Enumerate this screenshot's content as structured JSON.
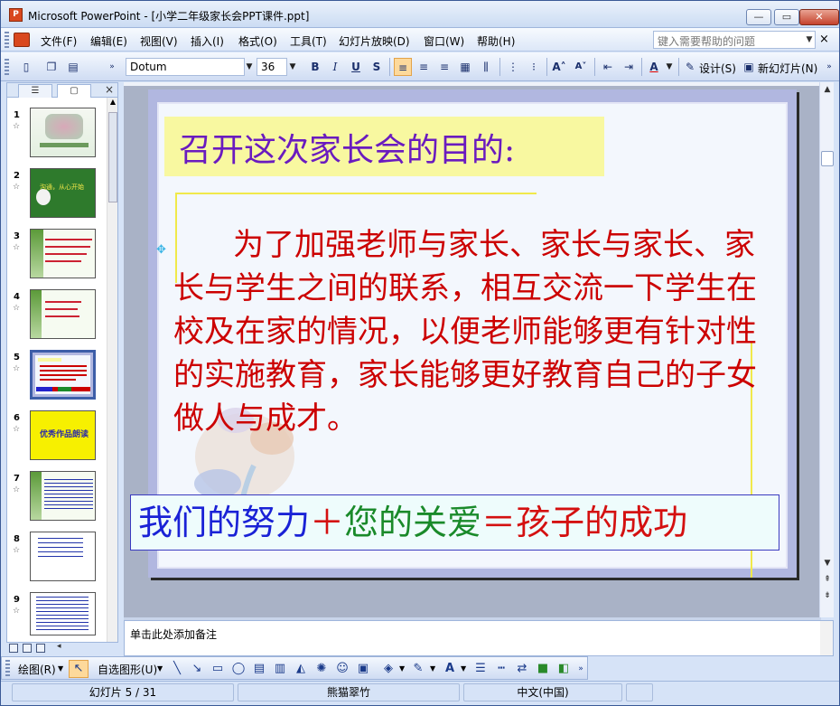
{
  "window": {
    "app_icon": "P",
    "title": "Microsoft PowerPoint - [小学二年级家长会PPT课件.ppt]",
    "minimize": "—",
    "restore": "▭",
    "close": "✕"
  },
  "menubar": {
    "items": [
      "文件(F)",
      "编辑(E)",
      "视图(V)",
      "插入(I)",
      "格式(O)",
      "工具(T)",
      "幻灯片放映(D)",
      "窗口(W)",
      "帮助(H)"
    ],
    "help_placeholder": "键入需要帮助的问题",
    "close_label": "×"
  },
  "toolbar": {
    "font_name": "Dotum",
    "font_size": "36",
    "bold": "B",
    "italic": "I",
    "underline": "U",
    "shadow": "S",
    "design_label": "设计(S)",
    "new_slide_label": "新幻灯片(N)",
    "font_color_label": "A",
    "grow_font": "A˄",
    "shrink_font": "A˅"
  },
  "side_panel": {
    "tabs": [
      "☰",
      "▢"
    ],
    "close": "×",
    "slides": [
      {
        "num": "1",
        "star": "☆"
      },
      {
        "num": "2",
        "star": "☆",
        "thumb_text": "沟通，从心开始"
      },
      {
        "num": "3",
        "star": "☆"
      },
      {
        "num": "4",
        "star": "☆"
      },
      {
        "num": "5",
        "star": "☆"
      },
      {
        "num": "6",
        "star": "☆",
        "thumb_text": "优秀作品朗读"
      },
      {
        "num": "7",
        "star": "☆"
      },
      {
        "num": "8",
        "star": "☆"
      },
      {
        "num": "9",
        "star": "☆"
      }
    ],
    "selected_slide": 5
  },
  "slide": {
    "title": "召开这次家长会的目的:",
    "body": "为了加强老师与家长、家长与家长、家长与学生之间的联系，相互交流一下学生在校及在家的情况，以便老师能够更有针对性的实施教育，家长能够更好教育自己的子女做人与成才。",
    "slogan": {
      "part1": "我们的努力",
      "plus": "＋",
      "part2": "您的关爱",
      "equals": "＝",
      "part3": "孩子的成功"
    },
    "colors": {
      "title": "#6a1bbf",
      "body": "#cc0000",
      "slogan_blue": "#1a22d6",
      "slogan_green": "#1a8a2a",
      "slogan_red": "#d41010"
    }
  },
  "notes": {
    "placeholder": "单击此处添加备注"
  },
  "drawbar": {
    "draw_label": "绘图(R)",
    "autoshape_label": "自选图形(U)"
  },
  "statusbar": {
    "slide_position": "幻灯片 5 / 31",
    "design_name": "熊猫翠竹",
    "language": "中文(中国)"
  }
}
